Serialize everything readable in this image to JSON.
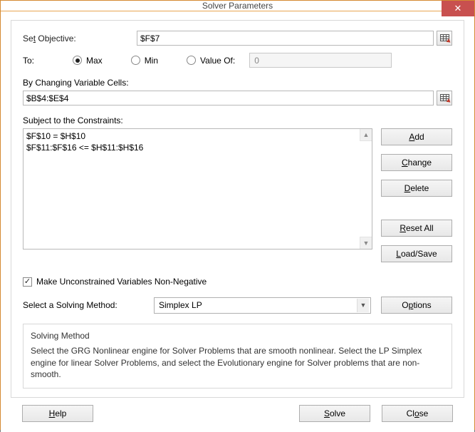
{
  "window": {
    "title": "Solver Parameters"
  },
  "labels": {
    "set_objective_pre": "Se",
    "set_objective_u": "t",
    "set_objective_post": " Objective:",
    "to": "To:",
    "max_u": "M",
    "max_post": "ax",
    "min_pre": "Mi",
    "min_u": "n",
    "valueof_u": "V",
    "valueof_post": "alue Of:",
    "changing_u": "B",
    "changing_post": "y Changing Variable Cells:",
    "subject_pre": "S",
    "subject_u": "u",
    "subject_post": "bject to the Constraints:",
    "nonneg_pre": "Ma",
    "nonneg_u": "k",
    "nonneg_post": "e Unconstrained Variables Non-Negative",
    "select_method_pre": "S",
    "select_method_u": "e",
    "select_method_post": "lect a Solving Method:",
    "desc_heading": "Solving Method",
    "desc_body": "Select the GRG Nonlinear engine for Solver Problems that are smooth nonlinear. Select the LP Simplex engine for linear Solver Problems, and select the Evolutionary engine for Solver problems that are non-smooth."
  },
  "values": {
    "objective": "$F$7",
    "valueof": "0",
    "changing_cells": "$B$4:$E$4",
    "solving_method": "Simplex LP",
    "to_selected": "max",
    "nonneg_checked": true
  },
  "constraints": [
    "$F$10 = $H$10",
    "$F$11:$F$16 <= $H$11:$H$16"
  ],
  "buttons": {
    "add_u": "A",
    "add_post": "dd",
    "change_u": "C",
    "change_post": "hange",
    "delete_u": "D",
    "delete_post": "elete",
    "reset_u": "R",
    "reset_post": "eset All",
    "loadsave_u": "L",
    "loadsave_post": "oad/Save",
    "options_pre": "O",
    "options_u": "p",
    "options_post": "tions",
    "help_u": "H",
    "help_post": "elp",
    "solve_u": "S",
    "solve_post": "olve",
    "close_pre": "Cl",
    "close_u": "o",
    "close_post": "se"
  }
}
